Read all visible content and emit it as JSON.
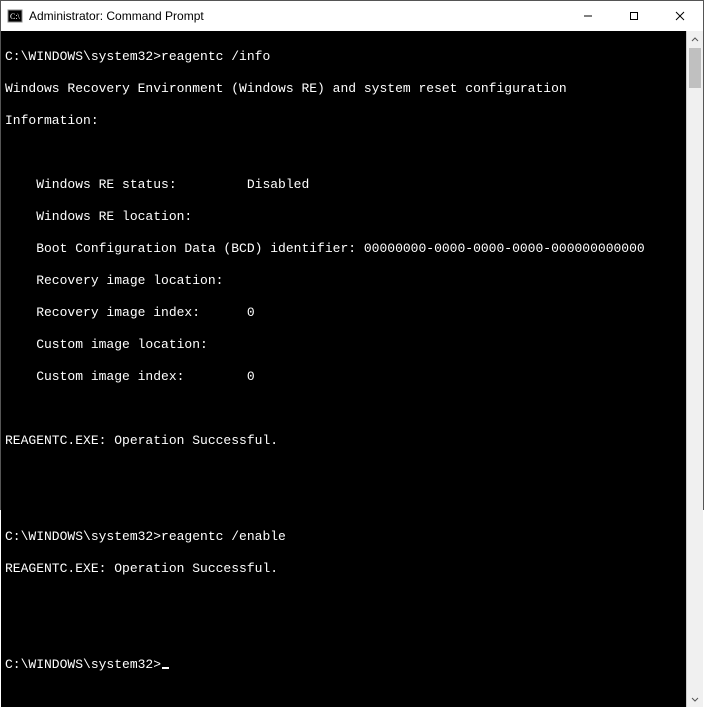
{
  "titlebar": {
    "title": "Administrator: Command Prompt"
  },
  "prompt": "C:\\WINDOWS\\system32>",
  "command1": "reagentc /info",
  "output1_header1": "Windows Recovery Environment (Windows RE) and system reset configuration",
  "output1_header2": "Information:",
  "info_lines": {
    "re_status": "    Windows RE status:         Disabled",
    "re_location": "    Windows RE location:",
    "bcd": "    Boot Configuration Data (BCD) identifier: 00000000-0000-0000-0000-000000000000",
    "rec_img_loc": "    Recovery image location:",
    "rec_img_idx": "    Recovery image index:      0",
    "cust_img_loc": "    Custom image location:",
    "cust_img_idx": "    Custom image index:        0"
  },
  "op_success": "REAGENTC.EXE: Operation Successful.",
  "command2": "reagentc /enable"
}
